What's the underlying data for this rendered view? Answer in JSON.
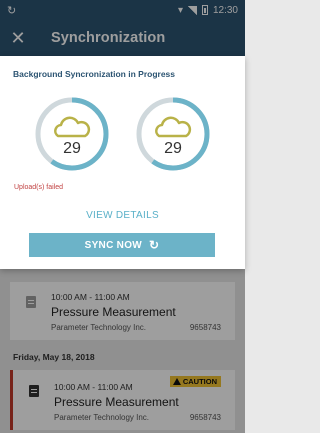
{
  "status_bar": {
    "time": "12:30",
    "sync_glyph": "↻"
  },
  "app_bar": {
    "title": "Synchronization",
    "close_glyph": "✕"
  },
  "sync_panel": {
    "heading": "Background Syncronization in Progress",
    "rings": [
      {
        "count": "29",
        "icon": "cloud-icon",
        "progress": 0.6
      },
      {
        "count": "29",
        "icon": "cloud-icon",
        "progress": 0.6
      }
    ],
    "failed_text": "Upload(s) failed",
    "details_label": "VIEW DETAILS",
    "sync_button_label": "SYNC NOW",
    "sync_button_icon": "↻"
  },
  "cards": [
    {
      "time": "10:00 AM - 11:00 AM",
      "title": "Pressure Measurement",
      "company": "Parameter Technology Inc.",
      "id": "9658743",
      "icon": "document-icon"
    }
  ],
  "date_header": "Friday, May 18, 2018",
  "cards_after_date": [
    {
      "time": "10:00 AM - 11:00 AM",
      "title": "Pressure Measurement",
      "company": "Parameter Technology Inc.",
      "id": "9658743",
      "badge": "CAUTION",
      "icon": "clipboard-icon"
    }
  ],
  "colors": {
    "primary": "#2c5472",
    "accent": "#6cb3c8",
    "ring_track": "#cfd8dc",
    "cloud": "#b9b248",
    "error": "#c24343",
    "caution": "#f1c232",
    "alert_bar": "#c0392b"
  }
}
